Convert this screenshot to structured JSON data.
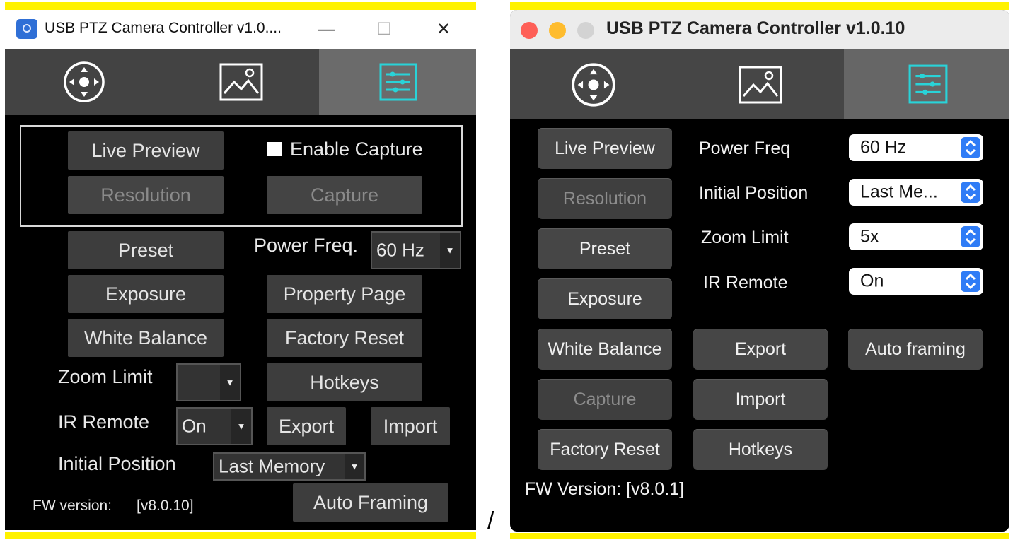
{
  "windows_app": {
    "title": "USB PTZ Camera Controller v1.0....",
    "window_controls": {
      "minimize": "—",
      "maximize": "☐",
      "close": "✕"
    },
    "tabs": [
      {
        "icon": "joystick-icon"
      },
      {
        "icon": "image-icon"
      },
      {
        "icon": "settings-sliders-icon",
        "active": true
      }
    ],
    "capture_group": {
      "live_preview": "Live Preview",
      "enable_capture_label": "Enable Capture",
      "enable_capture_checked": false,
      "resolution": "Resolution",
      "capture": "Capture"
    },
    "buttons": {
      "preset": "Preset",
      "exposure": "Exposure",
      "white_balance": "White Balance",
      "property_page": "Property Page",
      "factory_reset": "Factory Reset",
      "hotkeys": "Hotkeys",
      "export": "Export",
      "import": "Import",
      "auto_framing": "Auto Framing"
    },
    "power_freq": {
      "label": "Power Freq.",
      "value": "60 Hz"
    },
    "zoom_limit": {
      "label": "Zoom Limit",
      "value": ""
    },
    "ir_remote": {
      "label": "IR Remote",
      "value": "On"
    },
    "initial_position": {
      "label": "Initial Position",
      "value": "Last Memory"
    },
    "fw": {
      "label": "FW version:",
      "value": "[v8.0.10]"
    }
  },
  "mac_app": {
    "title": "USB PTZ Camera Controller v1.0.10",
    "traffic_lights": {
      "close": "#fe5f57",
      "minimize": "#febc2e",
      "zoom": "#d3d3d3"
    },
    "tabs": [
      {
        "icon": "joystick-icon"
      },
      {
        "icon": "image-icon"
      },
      {
        "icon": "settings-sliders-icon",
        "active": true
      }
    ],
    "buttons": {
      "live_preview": "Live Preview",
      "resolution": "Resolution",
      "preset": "Preset",
      "exposure": "Exposure",
      "white_balance": "White Balance",
      "capture": "Capture",
      "factory_reset": "Factory Reset",
      "export": "Export",
      "import": "Import",
      "hotkeys": "Hotkeys",
      "auto_framing": "Auto framing"
    },
    "settings": [
      {
        "label": "Power Freq",
        "value": "60 Hz"
      },
      {
        "label": "Initial Position",
        "value": "Last Me..."
      },
      {
        "label": "Zoom Limit",
        "value": "5x"
      },
      {
        "label": "IR Remote",
        "value": "On"
      }
    ],
    "fw": "FW Version: [v8.0.1]"
  },
  "separator": "/",
  "colors": {
    "frame_yellow": "#fff200",
    "active_tab_icon": "#29d3d8",
    "mac_popup_accent": "#2f7cf6"
  }
}
